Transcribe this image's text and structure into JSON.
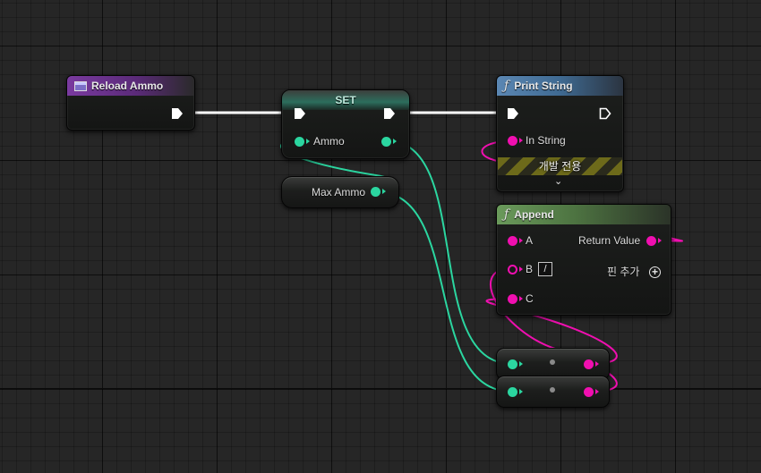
{
  "colors": {
    "exec": "#ffffff",
    "float_pin": "#2bd6a0",
    "string_pin": "#f00fb0",
    "event_header": "#7a3aa0",
    "set_header": "#3e8f76",
    "print_header": "#4f7fae",
    "append_header": "#5c8a4f"
  },
  "nodes": {
    "reload_ammo": {
      "title": "Reload Ammo",
      "icon": "event-icon"
    },
    "set": {
      "title": "SET",
      "pin_ammo": "Ammo"
    },
    "max_ammo": {
      "label": "Max Ammo"
    },
    "print_string": {
      "title": "Print String",
      "icon": "function-icon",
      "pin_in_string": "In String",
      "dev_only": "개발 전용"
    },
    "append": {
      "title": "Append",
      "icon": "function-icon",
      "pin_a": "A",
      "pin_b": "B",
      "pin_b_value": "/",
      "pin_c": "C",
      "return_value": "Return Value",
      "add_pin": "핀 추가"
    }
  }
}
